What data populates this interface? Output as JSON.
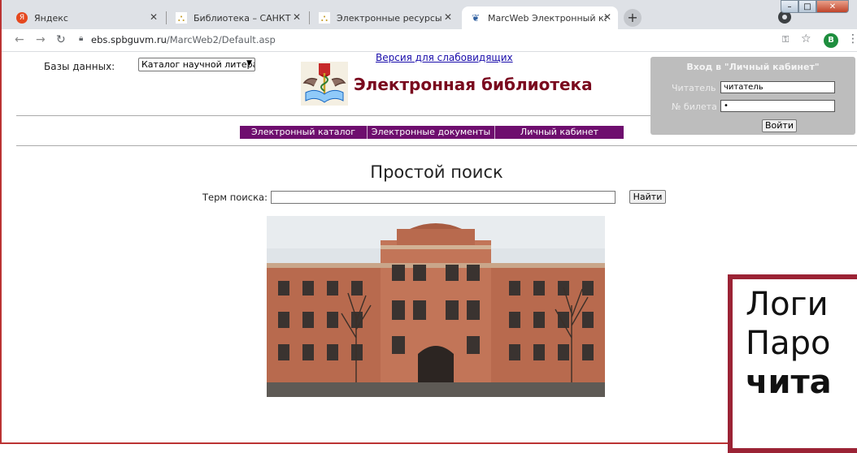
{
  "tabs": [
    {
      "label": "Яндекс",
      "favicon": "yandex-icon"
    },
    {
      "label": "Библиотека – САНКТ-ПЕТЕРБУРГ",
      "favicon": "library-icon"
    },
    {
      "label": "Электронные ресурсы – САНКТ",
      "favicon": "library-icon"
    },
    {
      "label": "MarcWeb Электронный каталог",
      "favicon": "marcweb-icon",
      "active": true
    }
  ],
  "browser": {
    "url_domain": "ebs.spbguvm.ru",
    "url_path": "/MarcWeb2/Default.asp",
    "avatar_letter": "В",
    "new_tab": "+"
  },
  "header": {
    "db_label": "Базы данных:",
    "db_selected": "Каталог научной литерат",
    "low_vision_link": "Версия для слабовидящих",
    "title": "Электронная библиотека"
  },
  "login": {
    "title": "Вход в \"Личный кабинет\"",
    "reader_label": "Читатель",
    "reader_value": "читатель",
    "ticket_label": "№ билета",
    "ticket_value": "•",
    "submit": "Войти"
  },
  "menu": [
    {
      "label": "Электронный каталог"
    },
    {
      "label": "Электронные документы"
    },
    {
      "label": "Личный кабинет"
    }
  ],
  "search": {
    "title": "Простой поиск",
    "term_label": "Терм поиска:",
    "term_value": "",
    "button": "Найти"
  },
  "hint": {
    "line1": "Логи",
    "line2": "Паро",
    "line3": "чита"
  },
  "colors": {
    "title": "#7a0a1e",
    "menubar": "#6e0e6e",
    "login_box": "#bdbdbd",
    "hint_border": "#9b2335"
  }
}
